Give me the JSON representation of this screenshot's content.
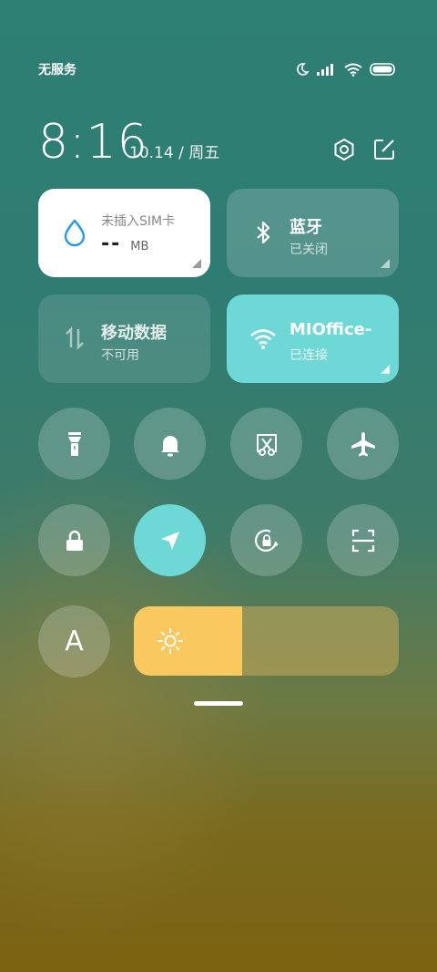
{
  "status_bar": {
    "carrier": "无服务",
    "icons": [
      "moon-icon",
      "signal-icon",
      "wifi-icon",
      "battery-icon"
    ]
  },
  "header": {
    "time": "8:16",
    "date": "10.14 / 周五",
    "actions": [
      "settings-icon",
      "edit-icon"
    ]
  },
  "tiles": {
    "data": {
      "title": "未插入SIM卡",
      "value": "--",
      "unit": "MB",
      "icon": "water-drop-icon"
    },
    "bluetooth": {
      "title": "蓝牙",
      "status": "已关闭",
      "icon": "bluetooth-icon"
    },
    "mobile_data": {
      "title": "移动数据",
      "status": "不可用",
      "icon": "data-arrows-icon"
    },
    "wifi": {
      "title": "MIOffice-",
      "status": "已连接",
      "icon": "wifi-icon"
    }
  },
  "toggles": [
    {
      "name": "flashlight-toggle",
      "icon": "flashlight-icon",
      "active": false
    },
    {
      "name": "mute-toggle",
      "icon": "bell-icon",
      "active": false
    },
    {
      "name": "screenshot-toggle",
      "icon": "screenshot-icon",
      "active": false
    },
    {
      "name": "airplane-mode-toggle",
      "icon": "airplane-icon",
      "active": false
    },
    {
      "name": "lock-screen-toggle",
      "icon": "lock-icon",
      "active": false
    },
    {
      "name": "location-toggle",
      "icon": "location-arrow-icon",
      "active": true
    },
    {
      "name": "rotation-lock-toggle",
      "icon": "rotation-lock-icon",
      "active": false
    },
    {
      "name": "scan-toggle",
      "icon": "scan-icon",
      "active": false
    }
  ],
  "auto_brightness": {
    "label": "A",
    "icon": "auto-brightness-icon"
  },
  "brightness": {
    "level": 0.41,
    "icon": "sun-icon",
    "colors": {
      "fill": "#f9c85e",
      "track": "#c8aa5a"
    }
  },
  "colors": {
    "accent": "#6ed8d6",
    "data_icon": "#2196f3"
  }
}
